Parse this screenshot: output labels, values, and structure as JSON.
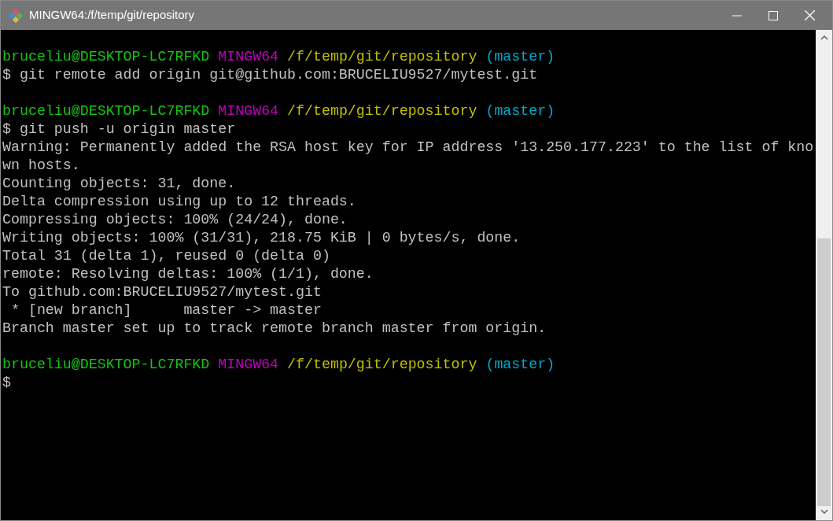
{
  "window": {
    "title": "MINGW64:/f/temp/git/repository"
  },
  "lines": [
    {
      "kind": "blank"
    },
    {
      "kind": "prompt",
      "user": "bruceliu@DESKTOP-LC7RFKD",
      "system": "MINGW64",
      "path": "/f/temp/git/repository",
      "branch": "(master)"
    },
    {
      "kind": "command",
      "text": "$ git remote add origin git@github.com:BRUCELIU9527/mytest.git"
    },
    {
      "kind": "blank"
    },
    {
      "kind": "prompt",
      "user": "bruceliu@DESKTOP-LC7RFKD",
      "system": "MINGW64",
      "path": "/f/temp/git/repository",
      "branch": "(master)"
    },
    {
      "kind": "command",
      "text": "$ git push -u origin master"
    },
    {
      "kind": "output",
      "text": "Warning: Permanently added the RSA host key for IP address '13.250.177.223' to the list of kno"
    },
    {
      "kind": "output",
      "text": "wn hosts."
    },
    {
      "kind": "output",
      "text": "Counting objects: 31, done."
    },
    {
      "kind": "output",
      "text": "Delta compression using up to 12 threads."
    },
    {
      "kind": "output",
      "text": "Compressing objects: 100% (24/24), done."
    },
    {
      "kind": "output",
      "text": "Writing objects: 100% (31/31), 218.75 KiB | 0 bytes/s, done."
    },
    {
      "kind": "output",
      "text": "Total 31 (delta 1), reused 0 (delta 0)"
    },
    {
      "kind": "output",
      "text": "remote: Resolving deltas: 100% (1/1), done."
    },
    {
      "kind": "output",
      "text": "To github.com:BRUCELIU9527/mytest.git"
    },
    {
      "kind": "output",
      "text": " * [new branch]      master -> master"
    },
    {
      "kind": "output",
      "text": "Branch master set up to track remote branch master from origin."
    },
    {
      "kind": "blank"
    },
    {
      "kind": "prompt",
      "user": "bruceliu@DESKTOP-LC7RFKD",
      "system": "MINGW64",
      "path": "/f/temp/git/repository",
      "branch": "(master)"
    },
    {
      "kind": "command",
      "text": "$"
    }
  ]
}
